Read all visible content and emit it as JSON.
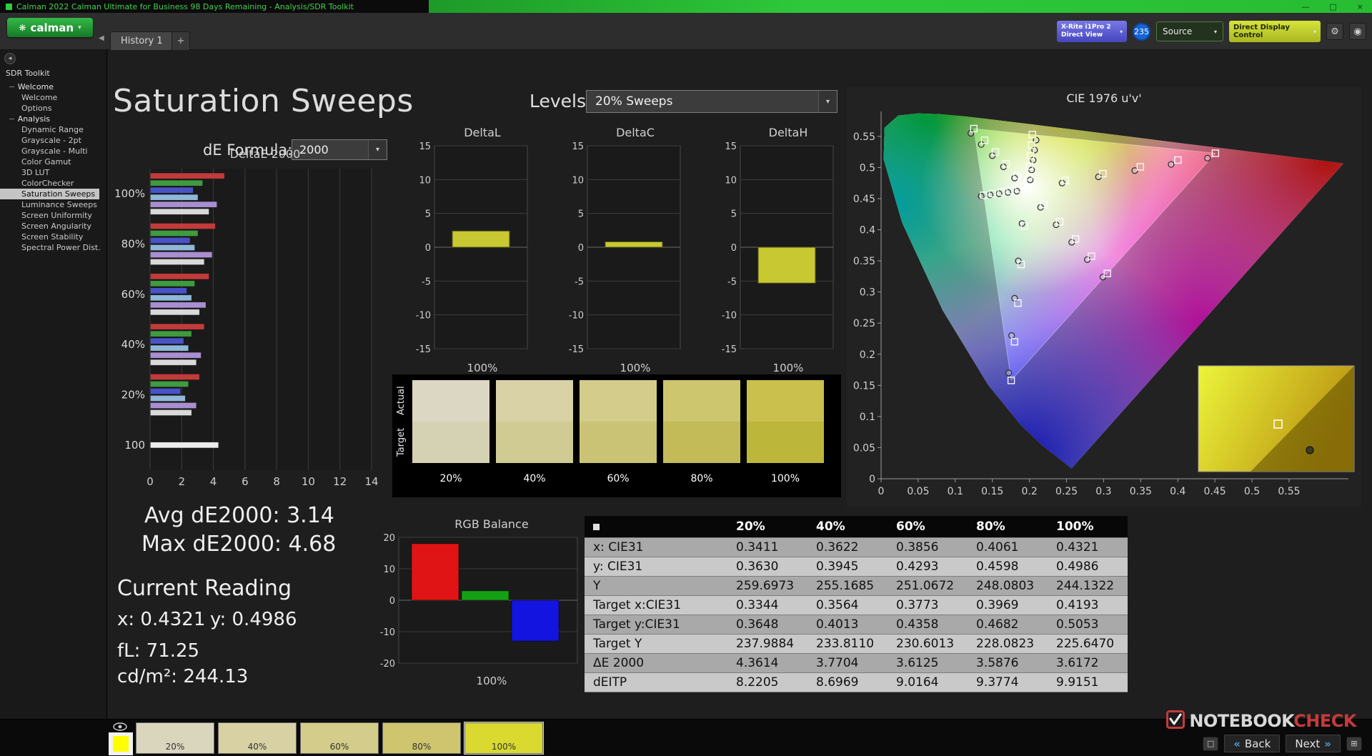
{
  "colors": {
    "accent_green": "#2fae3c",
    "bar_yellow": "#c8c832"
  },
  "titlebar": {
    "title": "Calman 2022 Calman Ultimate for Business 98 Days Remaining  - Analysis/SDR Toolkit",
    "minimize": "—",
    "maximize": "□",
    "close": "×"
  },
  "logo": {
    "text": "calman",
    "caret": "▾",
    "glyph": "❋"
  },
  "tab_row": {
    "history_tab": "History 1",
    "new_tab": "+",
    "collapse": "◀"
  },
  "device_bar": {
    "meter_line1": "X-Rite i1Pro 2",
    "meter_line2": "Direct View",
    "badge": "235",
    "source": "Source",
    "display_control": "Direct Display Control",
    "caret": "▾",
    "gear": "⚙",
    "power": "◉"
  },
  "sidebar": {
    "title": "SDR Toolkit",
    "tree": [
      {
        "label": "Welcome",
        "level": 0
      },
      {
        "label": "Welcome",
        "level": 1
      },
      {
        "label": "Options",
        "level": 1
      },
      {
        "label": "Analysis",
        "level": 0
      },
      {
        "label": "Dynamic Range",
        "level": 1
      },
      {
        "label": "Grayscale - 2pt",
        "level": 1
      },
      {
        "label": "Grayscale - Multi",
        "level": 1
      },
      {
        "label": "Color Gamut",
        "level": 1
      },
      {
        "label": "3D LUT",
        "level": 1
      },
      {
        "label": "ColorChecker",
        "level": 1
      },
      {
        "label": "Saturation Sweeps",
        "level": 1,
        "selected": true
      },
      {
        "label": "Luminance Sweeps",
        "level": 1
      },
      {
        "label": "Screen Uniformity",
        "level": 1
      },
      {
        "label": "Screen Angularity",
        "level": 1
      },
      {
        "label": "Screen Stability",
        "level": 1
      },
      {
        "label": "Spectral Power Dist.",
        "level": 1
      }
    ]
  },
  "page": {
    "title": "Saturation Sweeps",
    "levels_label": "Levels:",
    "levels_value": "20% Sweeps",
    "formula_label": "dE Formula:",
    "formula_value": "2000"
  },
  "stats": {
    "avg": "Avg dE2000: 3.14",
    "max": "Max dE2000: 4.68",
    "current_heading": "Current Reading",
    "x": "x: 0.4321",
    "y": "y: 0.4986",
    "fl": "fL: 71.25",
    "cdm2": "cd/m²: 244.13"
  },
  "charts": {
    "deltae_bars": {
      "type": "bar",
      "title": "DeltaE 2000",
      "xlim": [
        0,
        14
      ],
      "xticks": [
        0,
        2,
        4,
        6,
        8,
        10,
        12,
        14
      ],
      "series_colors": [
        "#c23b3b",
        "#3f9b3f",
        "#4953c8",
        "#8fb7d9",
        "#a98fd1",
        "#d9d9d9"
      ],
      "groups": [
        {
          "label": "100%",
          "values": [
            4.68,
            3.3,
            2.7,
            3.0,
            4.2,
            3.7
          ]
        },
        {
          "label": "80%",
          "values": [
            4.1,
            3.0,
            2.5,
            2.8,
            3.9,
            3.4
          ]
        },
        {
          "label": "60%",
          "values": [
            3.7,
            2.8,
            2.3,
            2.6,
            3.5,
            3.1
          ]
        },
        {
          "label": "40%",
          "values": [
            3.4,
            2.6,
            2.1,
            2.4,
            3.2,
            2.9
          ]
        },
        {
          "label": "20%",
          "values": [
            3.1,
            2.4,
            1.9,
            2.2,
            2.9,
            2.6
          ]
        },
        {
          "label": "100",
          "values": [
            4.3
          ],
          "colors": [
            "#ececec"
          ]
        }
      ]
    },
    "delta_small": {
      "type": "bar",
      "ylim": [
        -15,
        15
      ],
      "yticks": [
        15,
        10,
        5,
        0,
        -5,
        -10,
        -15
      ],
      "xlabel": "100%",
      "bar_color": "#c8c832",
      "charts": [
        {
          "title": "DeltaL",
          "value": 2.4
        },
        {
          "title": "DeltaC",
          "value": 0.8
        },
        {
          "title": "DeltaH",
          "value": -5.3
        }
      ]
    },
    "swatches": {
      "actual_label": "Actual",
      "target_label": "Target",
      "items": [
        {
          "label": "20%",
          "actual": "#dcd7c3",
          "target": "#d5d1b3"
        },
        {
          "label": "40%",
          "actual": "#d8d2a6",
          "target": "#d0cb92"
        },
        {
          "label": "60%",
          "actual": "#d3cc8b",
          "target": "#cac375"
        },
        {
          "label": "80%",
          "actual": "#cec56f",
          "target": "#c3ba58"
        },
        {
          "label": "100%",
          "actual": "#c9c04d",
          "target": "#bcb63a"
        }
      ]
    },
    "rgb_balance": {
      "type": "bar",
      "title": "RGB Balance",
      "ylim": [
        -20,
        20
      ],
      "yticks": [
        20,
        10,
        0,
        -10,
        -20
      ],
      "xlabel": "100%",
      "bars": [
        {
          "name": "red",
          "value": 18,
          "color": "#e01414"
        },
        {
          "name": "green",
          "value": 3,
          "color": "#14a014"
        },
        {
          "name": "blue",
          "value": -13,
          "color": "#1414e0"
        }
      ]
    },
    "cie": {
      "type": "scatter",
      "title": "CIE 1976 u'v'",
      "ticks": [
        "0",
        "0.05",
        "0.1",
        "0.15",
        "0.2",
        "0.25",
        "0.3",
        "0.35",
        "0.4",
        "0.45",
        "0.5",
        "0.55"
      ],
      "locus": [
        [
          0.2568,
          0.0166
        ],
        [
          0.2161,
          0.0549
        ],
        [
          0.1877,
          0.0871
        ],
        [
          0.1441,
          0.151
        ],
        [
          0.0828,
          0.2708
        ],
        [
          0.0282,
          0.4117
        ],
        [
          0.0035,
          0.5131
        ],
        [
          0.0046,
          0.5639
        ],
        [
          0.0231,
          0.5836
        ],
        [
          0.0501,
          0.5868
        ],
        [
          0.0792,
          0.5856
        ],
        [
          0.1127,
          0.5821
        ],
        [
          0.1531,
          0.5766
        ],
        [
          0.2026,
          0.5693
        ],
        [
          0.2623,
          0.5604
        ],
        [
          0.3316,
          0.5501
        ],
        [
          0.4034,
          0.5393
        ],
        [
          0.4692,
          0.5296
        ],
        [
          0.5202,
          0.5219
        ],
        [
          0.6234,
          0.5065
        ]
      ],
      "gamut_triangle": [
        [
          0.4507,
          0.5229
        ],
        [
          0.125,
          0.5625
        ],
        [
          0.1754,
          0.1579
        ]
      ],
      "white_point": [
        0.1978,
        0.4683
      ],
      "targets": [
        [
          0.2484,
          0.4792
        ],
        [
          0.299,
          0.4901
        ],
        [
          0.3495,
          0.5011
        ],
        [
          0.4001,
          0.512
        ],
        [
          0.4507,
          0.5229
        ],
        [
          0.1832,
          0.4871
        ],
        [
          0.1687,
          0.506
        ],
        [
          0.1541,
          0.5248
        ],
        [
          0.1396,
          0.5437
        ],
        [
          0.125,
          0.5625
        ],
        [
          0.1933,
          0.4062
        ],
        [
          0.1888,
          0.3441
        ],
        [
          0.1844,
          0.2821
        ],
        [
          0.1799,
          0.22
        ],
        [
          0.1754,
          0.1579
        ],
        [
          0.1859,
          0.4657
        ],
        [
          0.174,
          0.4631
        ],
        [
          0.1621,
          0.4606
        ],
        [
          0.1502,
          0.458
        ],
        [
          0.1383,
          0.4554
        ],
        [
          0.2192,
          0.4406
        ],
        [
          0.2407,
          0.4129
        ],
        [
          0.2621,
          0.3852
        ],
        [
          0.2836,
          0.3575
        ],
        [
          0.305,
          0.3298
        ],
        [
          0.199,
          0.4852
        ],
        [
          0.2002,
          0.5021
        ],
        [
          0.2014,
          0.519
        ],
        [
          0.2027,
          0.536
        ],
        [
          0.2039,
          0.5529
        ],
        [
          0.1978,
          0.4683
        ]
      ],
      "measurements": [
        [
          0.244,
          0.475
        ],
        [
          0.293,
          0.485
        ],
        [
          0.342,
          0.495
        ],
        [
          0.391,
          0.505
        ],
        [
          0.44,
          0.515
        ],
        [
          0.18,
          0.483
        ],
        [
          0.165,
          0.501
        ],
        [
          0.15,
          0.519
        ],
        [
          0.135,
          0.537
        ],
        [
          0.121,
          0.555
        ],
        [
          0.19,
          0.41
        ],
        [
          0.185,
          0.35
        ],
        [
          0.18,
          0.29
        ],
        [
          0.176,
          0.23
        ],
        [
          0.172,
          0.17
        ],
        [
          0.183,
          0.462
        ],
        [
          0.171,
          0.46
        ],
        [
          0.159,
          0.458
        ],
        [
          0.147,
          0.456
        ],
        [
          0.135,
          0.454
        ],
        [
          0.215,
          0.436
        ],
        [
          0.236,
          0.408
        ],
        [
          0.257,
          0.38
        ],
        [
          0.278,
          0.352
        ],
        [
          0.299,
          0.324
        ],
        [
          0.201,
          0.48
        ],
        [
          0.203,
          0.496
        ],
        [
          0.205,
          0.512
        ],
        [
          0.207,
          0.528
        ],
        [
          0.209,
          0.544
        ]
      ]
    }
  },
  "table": {
    "columns": [
      "20%",
      "40%",
      "60%",
      "80%",
      "100%"
    ],
    "rows": [
      {
        "label": "x: CIE31",
        "values": [
          "0.3411",
          "0.3622",
          "0.3856",
          "0.4061",
          "0.4321"
        ]
      },
      {
        "label": "y: CIE31",
        "values": [
          "0.3630",
          "0.3945",
          "0.4293",
          "0.4598",
          "0.4986"
        ]
      },
      {
        "label": "Y",
        "values": [
          "259.6973",
          "255.1685",
          "251.0672",
          "248.0803",
          "244.1322"
        ]
      },
      {
        "label": "Target x:CIE31",
        "values": [
          "0.3344",
          "0.3564",
          "0.3773",
          "0.3969",
          "0.4193"
        ]
      },
      {
        "label": "Target y:CIE31",
        "values": [
          "0.3648",
          "0.4013",
          "0.4358",
          "0.4682",
          "0.5053"
        ]
      },
      {
        "label": "Target Y",
        "values": [
          "237.9884",
          "233.8110",
          "230.6013",
          "228.0823",
          "225.6470"
        ]
      },
      {
        "label": "ΔE 2000",
        "values": [
          "4.3614",
          "3.7704",
          "3.6125",
          "3.5876",
          "3.6172"
        ]
      },
      {
        "label": "dEITP",
        "values": [
          "8.2205",
          "8.6969",
          "9.0164",
          "9.3774",
          "9.9151"
        ]
      }
    ]
  },
  "patch_bar": {
    "preview_color": "#ffff00",
    "patches": [
      {
        "label": "20%",
        "color": "#dad5bd"
      },
      {
        "label": "40%",
        "color": "#d7d1a4"
      },
      {
        "label": "60%",
        "color": "#d3cc8a"
      },
      {
        "label": "80%",
        "color": "#cec56e"
      },
      {
        "label": "100%",
        "color": "#d9d930",
        "selected": true
      }
    ]
  },
  "footer": {
    "back": "Back",
    "next": "Next",
    "back_chev": "«",
    "next_chev": "»",
    "win_btn": "□",
    "grid_btn": "⊞"
  },
  "watermark": {
    "part1": "NOTEBOOK",
    "part2": "CHECK"
  }
}
